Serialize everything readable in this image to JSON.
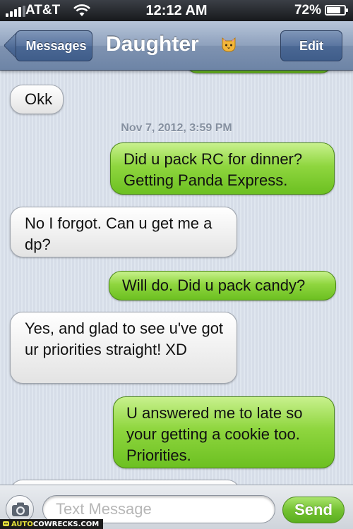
{
  "status_bar": {
    "carrier": "AT&T",
    "time": "12:12 AM",
    "battery": "72%",
    "battery_level": 0.72,
    "signal_bars": 4
  },
  "nav": {
    "back_label": "Messages",
    "title": "Daughter",
    "title_emoji_icon": "cat-face-icon",
    "edit_label": "Edit"
  },
  "thread": {
    "timestamp": "Nov 7, 2012, 3:59 PM",
    "messages": [
      {
        "from": "them",
        "text": "Okk"
      },
      {
        "from": "me",
        "text": "Did u pack RC for dinner? Getting Panda Express."
      },
      {
        "from": "them",
        "text": "No I forgot. Can u get me a dp?"
      },
      {
        "from": "me",
        "text": "Will do. Did u pack candy?"
      },
      {
        "from": "them",
        "text": "Yes, and glad to see u've got ur priorities straight! XD"
      },
      {
        "from": "me",
        "text": "U answered me to late so your getting a cookie too. Priorities."
      }
    ]
  },
  "composer": {
    "placeholder": "Text Message",
    "send_label": "Send",
    "camera_icon": "camera-icon"
  },
  "watermark": {
    "prefix": "AUTO",
    "text": "COWRECKS.COM"
  },
  "colors": {
    "outgoing_bubble": "#7ccb2f",
    "incoming_bubble": "#f2f2f2",
    "nav_bar": "#8ea1bd",
    "thread_background": "#dbe2ed"
  }
}
